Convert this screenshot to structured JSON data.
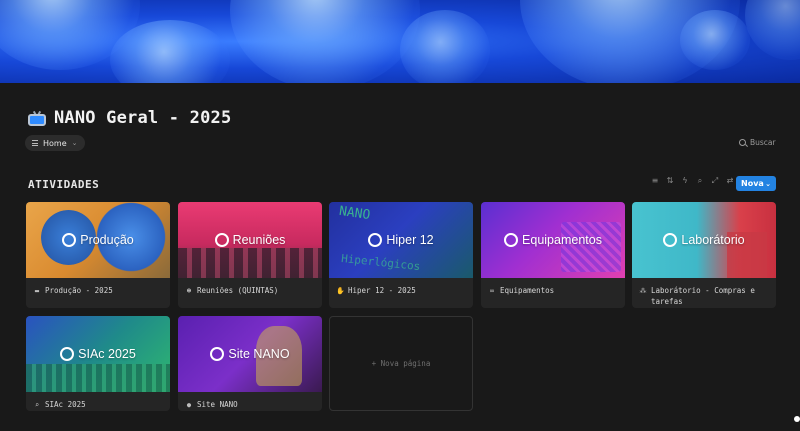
{
  "page": {
    "title": "NANO Geral - 2025",
    "icon": "tv-icon"
  },
  "view": {
    "label": "Home"
  },
  "search": {
    "label": "Buscar"
  },
  "section": {
    "title": "ATIVIDADES"
  },
  "toolbar": {
    "icons": [
      "filter-icon",
      "sort-icon",
      "lightning-icon",
      "search-icon",
      "expand-icon",
      "settings-icon"
    ],
    "new_label": "Nova"
  },
  "cards": [
    {
      "thumb_title": "Produção",
      "caption": "Produção - 2025",
      "caption_icon": "folder-icon",
      "accent": "#e08a2e"
    },
    {
      "thumb_title": "Reuniões",
      "caption": "Reuniões (QUINTAS)",
      "caption_icon": "people-icon",
      "accent": "#e0316b"
    },
    {
      "thumb_title": "Hiper 12",
      "caption": "Hiper 12 - 2025",
      "caption_icon": "hand-icon",
      "accent": "#2a37b8"
    },
    {
      "thumb_title": "Equipamentos",
      "caption": "Equipamentos",
      "caption_icon": "link-icon",
      "accent": "#b02fd1"
    },
    {
      "thumb_title": "Laborátorio",
      "caption": "Laborátorio - Compras e tarefas",
      "caption_icon": "molecule-icon",
      "accent": "#3fb8c8"
    },
    {
      "thumb_title": "SIAc 2025",
      "caption": "SIAc 2025",
      "caption_icon": "search-icon",
      "accent": "#1f9e8a"
    },
    {
      "thumb_title": "Site NANO",
      "caption": "Site NANO",
      "caption_icon": "globe-icon",
      "accent": "#7b2fc9"
    }
  ],
  "new_page": {
    "label": "+ Nova página"
  }
}
